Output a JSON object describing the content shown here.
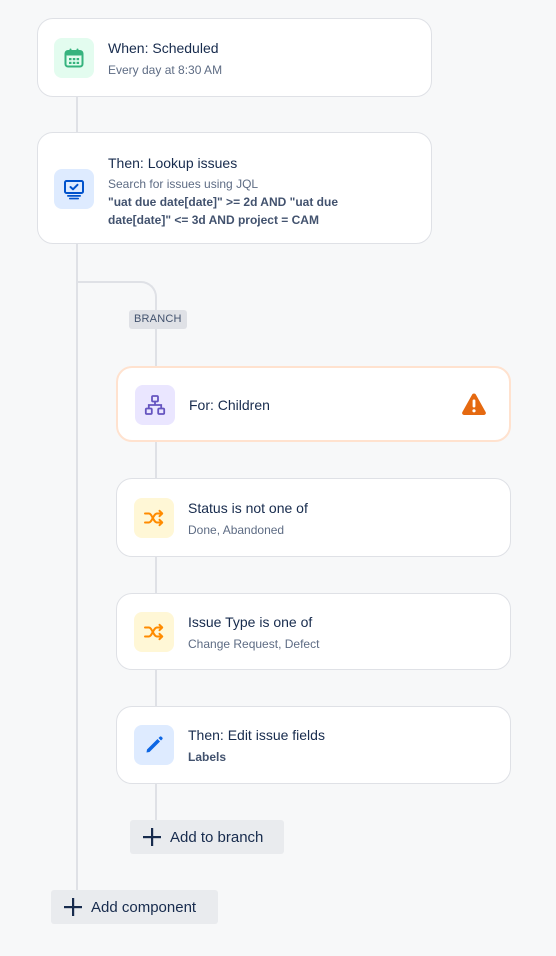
{
  "trigger": {
    "title": "When: Scheduled",
    "subtitle": "Every day at 8:30 AM",
    "icon": "calendar-icon",
    "icon_bg": "#e3fcef",
    "icon_color": "#36b37e"
  },
  "lookup": {
    "title": "Then: Lookup issues",
    "subtitle": "Search for issues using JQL",
    "jql_line1": "\"uat due date[date]\" >= 2d AND \"uat due",
    "jql_line2": "date[date]\" <= 3d AND project = CAM",
    "icon": "lookup-screen-icon",
    "icon_bg": "#deebff",
    "icon_color": "#0052cc"
  },
  "branch": {
    "badge": "BRANCH",
    "for_children": {
      "title": "For: Children",
      "icon": "hierarchy-icon",
      "icon_bg": "#eae6ff",
      "icon_color": "#6554c0",
      "warning_icon": "warning-icon",
      "warning_color": "#e56910"
    },
    "status_condition": {
      "title": "Status is not one of",
      "subtitle": "Done, Abandoned",
      "icon": "shuffle-icon",
      "icon_bg": "#fff7d6",
      "icon_color": "#ff8b00"
    },
    "issue_type_condition": {
      "title": "Issue Type is one of",
      "subtitle": "Change Request, Defect",
      "icon": "shuffle-icon",
      "icon_bg": "#fff7d6",
      "icon_color": "#ff8b00"
    },
    "edit_action": {
      "title": "Then: Edit issue fields",
      "subtitle": "Labels",
      "icon": "pencil-icon",
      "icon_bg": "#deebff",
      "icon_color": "#0c66e4"
    },
    "add_to_branch_label": "Add to branch"
  },
  "add_component_label": "Add component"
}
